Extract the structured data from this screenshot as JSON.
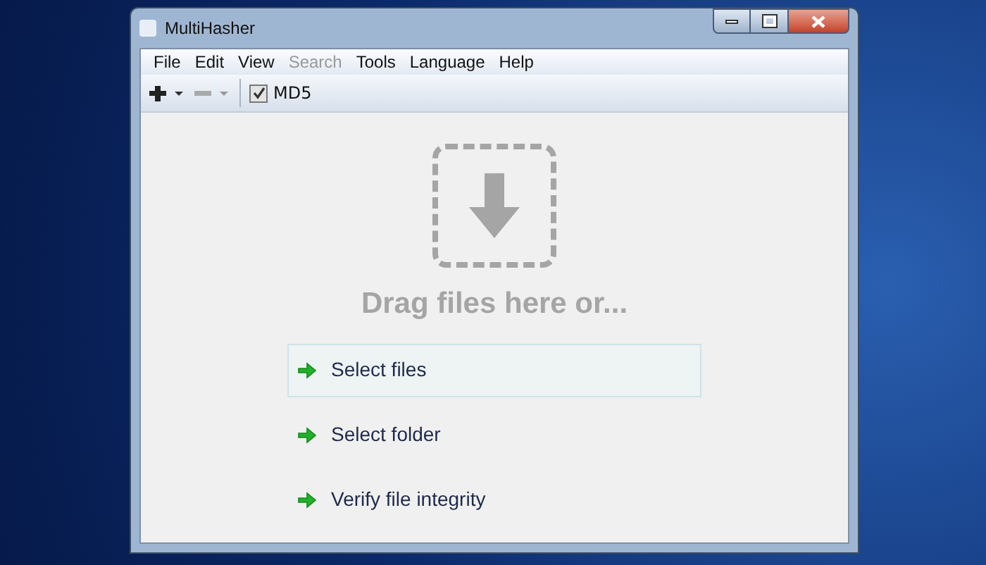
{
  "window": {
    "title": "MultiHasher"
  },
  "menu": [
    {
      "label": "File",
      "disabled": false
    },
    {
      "label": "Edit",
      "disabled": false
    },
    {
      "label": "View",
      "disabled": false
    },
    {
      "label": "Search",
      "disabled": true
    },
    {
      "label": "Tools",
      "disabled": false
    },
    {
      "label": "Language",
      "disabled": false
    },
    {
      "label": "Help",
      "disabled": false
    }
  ],
  "toolbar": {
    "algorithm": {
      "label": "MD5",
      "checked": true
    }
  },
  "drop_zone": {
    "prompt": "Drag files here or..."
  },
  "actions": [
    {
      "label": "Select files",
      "selected": true
    },
    {
      "label": "Select folder",
      "selected": false
    },
    {
      "label": "Verify file integrity",
      "selected": false
    }
  ]
}
